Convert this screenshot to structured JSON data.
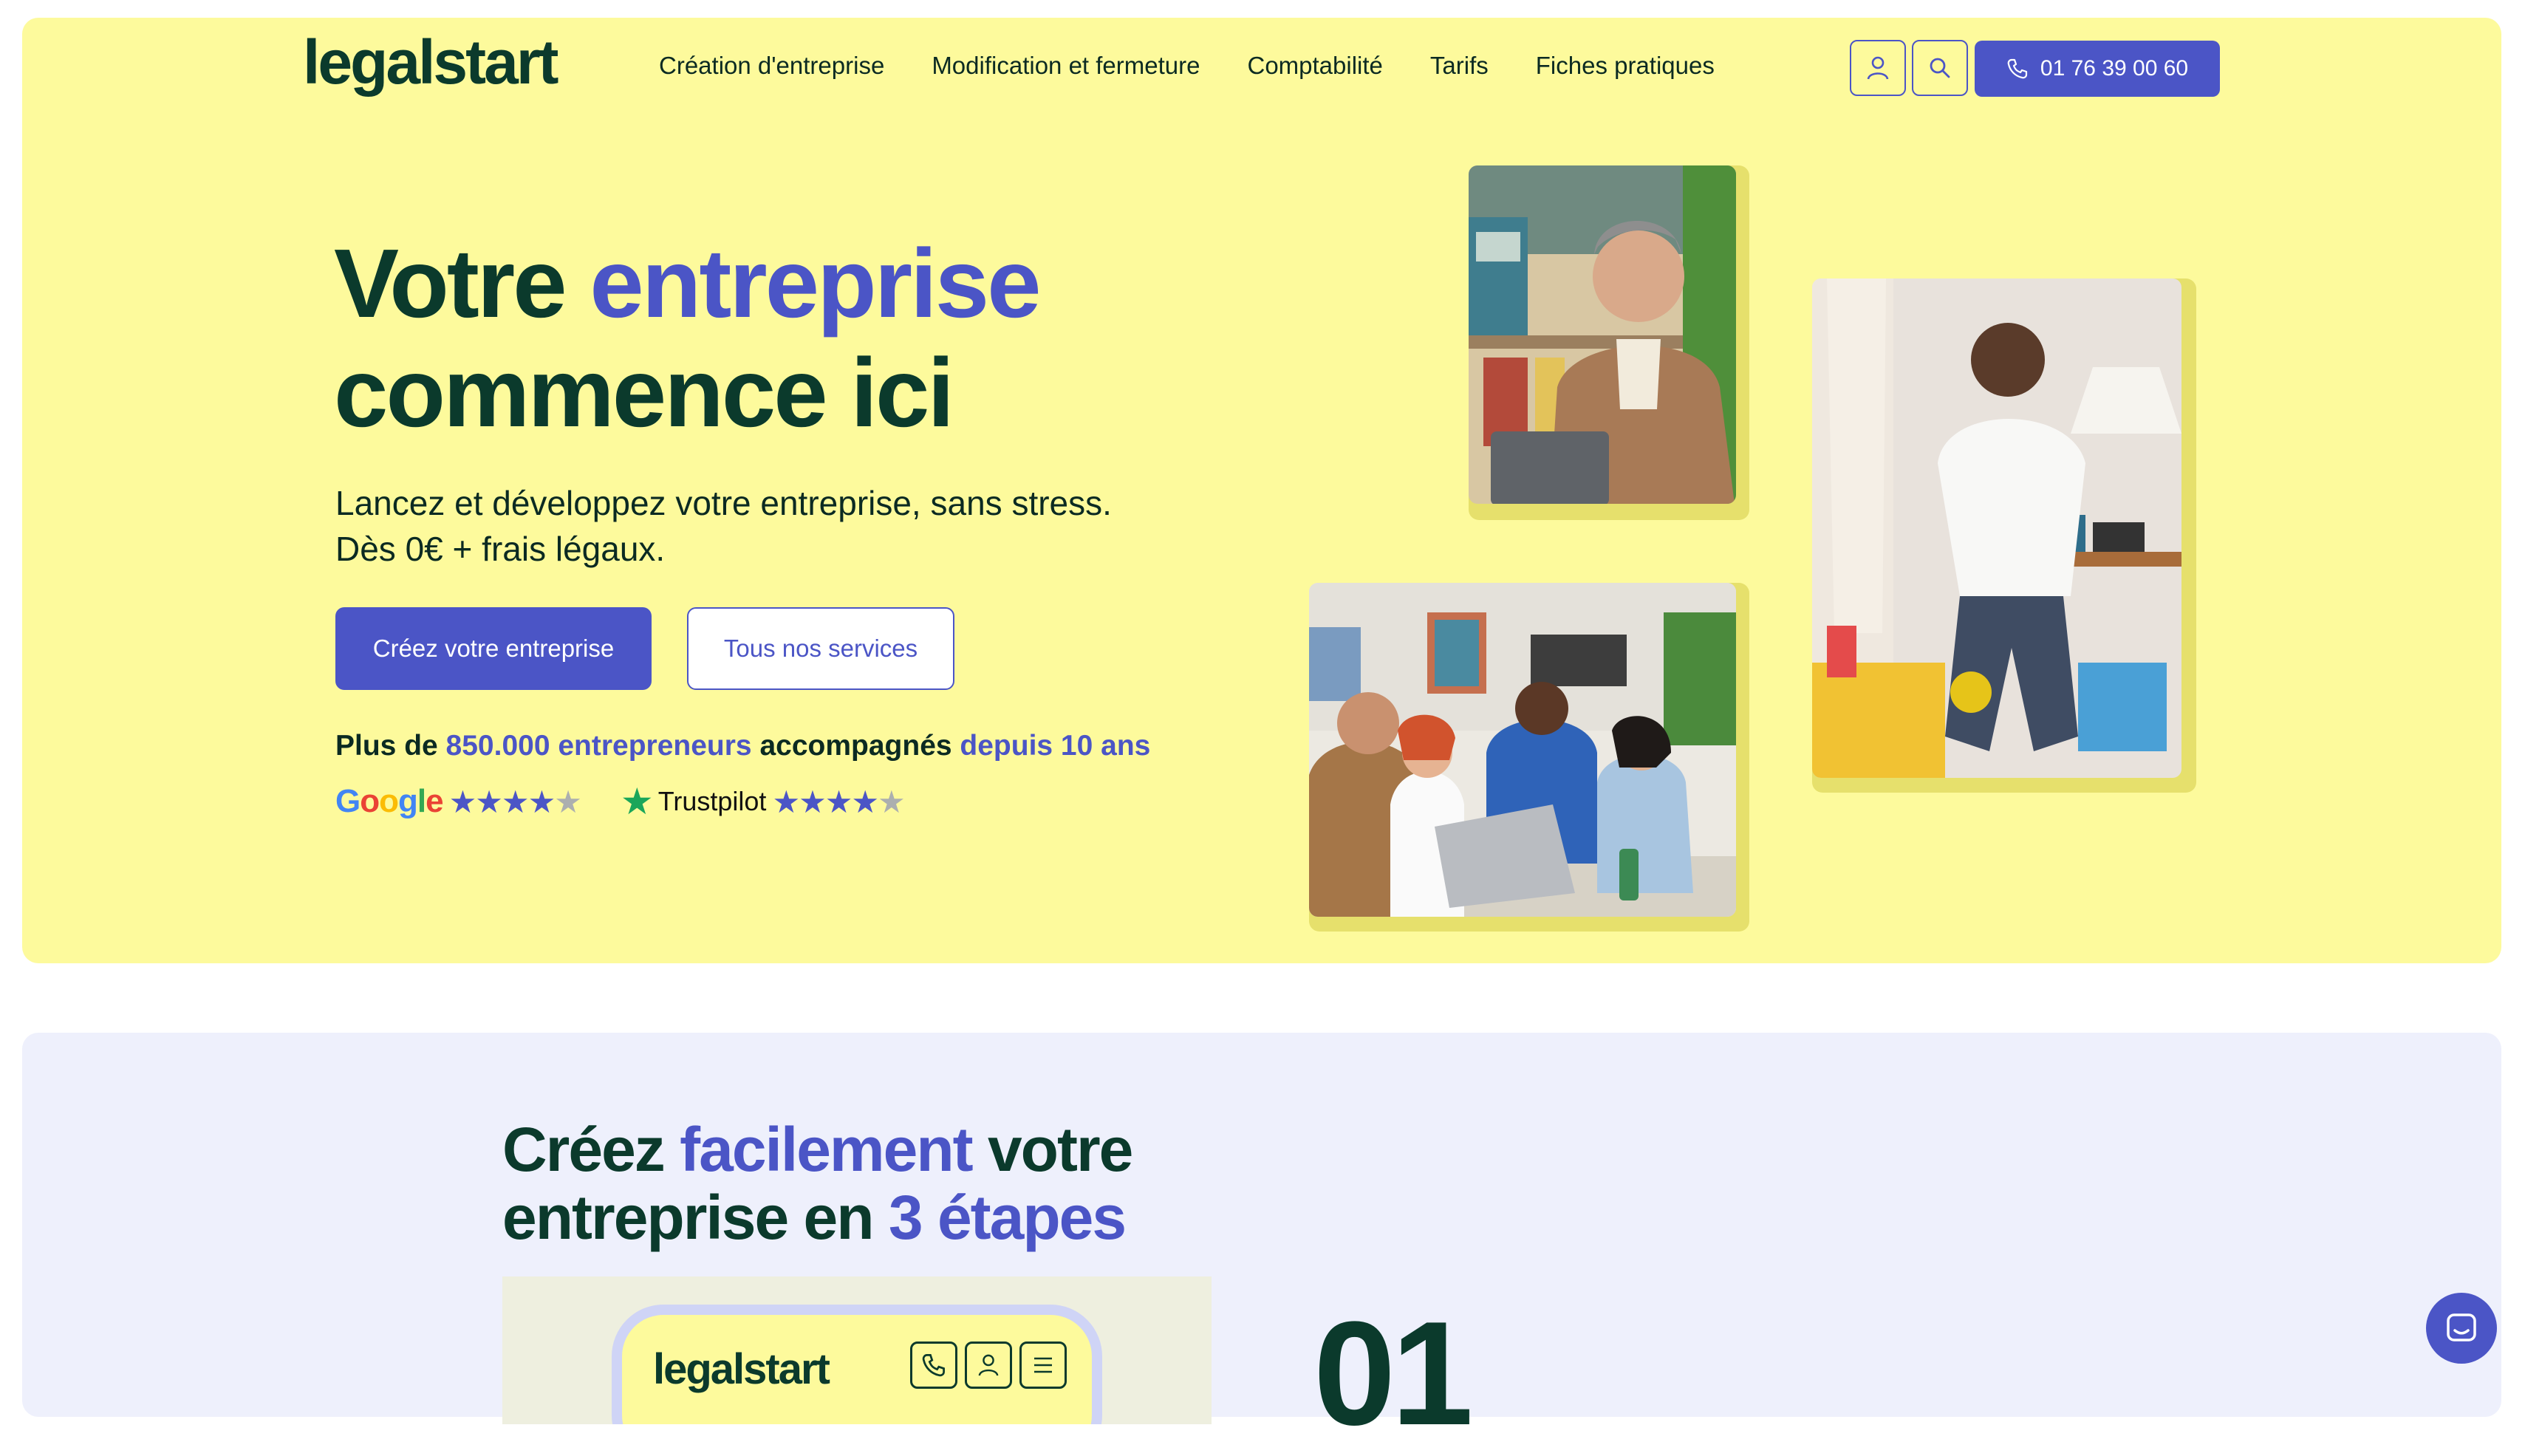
{
  "header": {
    "logo": "legalstart",
    "nav": [
      "Création d'entreprise",
      "Modification et fermeture",
      "Comptabilité",
      "Tarifs",
      "Fiches pratiques"
    ],
    "phone": "01 76 39 00 60",
    "icons": [
      "user-icon",
      "search-icon",
      "phone-icon"
    ]
  },
  "hero": {
    "title_part1": "Votre ",
    "title_accent": "entreprise",
    "title_part2": "commence ici",
    "subtitle_line1": "Lancez et développez votre entreprise, sans stress.",
    "subtitle_line2": "Dès 0€ + frais légaux.",
    "cta_primary": "Créez votre entreprise",
    "cta_secondary": "Tous nos services",
    "proof": {
      "t1": "Plus de ",
      "t2": "850.000 entrepreneurs",
      "t3": " accompagnés ",
      "t4": "depuis 10 ans"
    },
    "google_label": "Google",
    "google_rating_stars": 4.5,
    "trustpilot_label": "Trustpilot",
    "trustpilot_rating_stars": 4.5
  },
  "steps": {
    "title_part1": "Créez ",
    "title_accent1": "facilement",
    "title_part2": " votre",
    "title_part3": "entreprise en ",
    "title_accent2": "3 étapes",
    "mock_logo": "legalstart",
    "step_number": "01"
  },
  "colors": {
    "accent": "#4b55c6",
    "hero_bg": "#fdfa9c",
    "section_bg": "#eef0fc",
    "dark_green": "#0b3a2c",
    "trustpilot_green": "#1aa65a"
  }
}
